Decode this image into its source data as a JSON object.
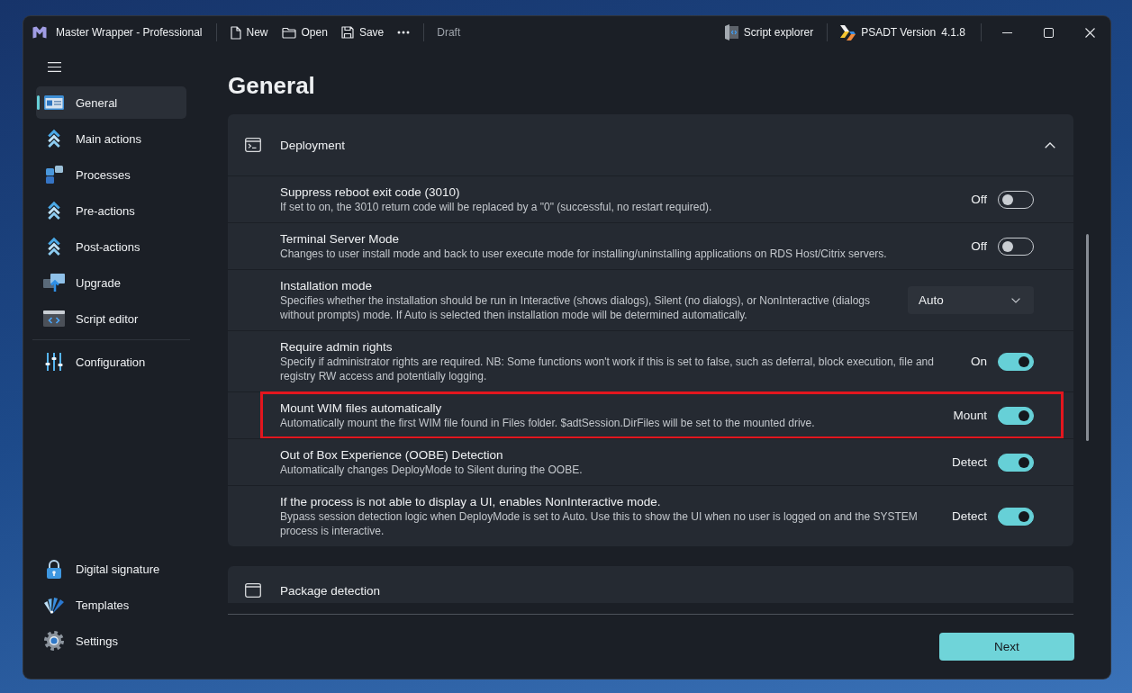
{
  "window": {
    "title": "Master Wrapper - Professional"
  },
  "toolbar": {
    "buttons": [
      {
        "label": "New"
      },
      {
        "label": "Open"
      },
      {
        "label": "Save"
      }
    ],
    "status": "Draft"
  },
  "title_bar_right": {
    "script_explorer": "Script explorer",
    "version_label": "PSADT Version",
    "version": "4.1.8"
  },
  "sidebar": {
    "main_items": [
      {
        "label": "General",
        "selected": true
      },
      {
        "label": "Main actions",
        "selected": false
      },
      {
        "label": "Processes",
        "selected": false
      },
      {
        "label": "Pre-actions",
        "selected": false
      },
      {
        "label": "Post-actions",
        "selected": false
      },
      {
        "label": "Upgrade",
        "selected": false
      },
      {
        "label": "Script editor",
        "selected": false
      }
    ],
    "tool_items": [
      {
        "label": "Configuration",
        "selected": false
      }
    ],
    "footer_items": [
      {
        "label": "Digital signature",
        "selected": false
      },
      {
        "label": "Templates",
        "selected": false
      },
      {
        "label": "Settings",
        "selected": false
      }
    ]
  },
  "page": {
    "title": "General",
    "next_button": "Next"
  },
  "sections": [
    {
      "title": "Deployment",
      "expanded": true,
      "rows": [
        {
          "kind": "toggle",
          "title": "Suppress reboot exit code (3010)",
          "description": "If set to on, the 3010 return code will be replaced by a \"0\" (successful, no restart required).",
          "value_label": "Off",
          "on": false,
          "highlighted": false
        },
        {
          "kind": "toggle",
          "title": "Terminal Server Mode",
          "description": "Changes to user install mode and back to user execute mode for installing/uninstalling applications on RDS Host/Citrix servers.",
          "value_label": "Off",
          "on": false,
          "highlighted": false
        },
        {
          "kind": "dropdown",
          "title": "Installation mode",
          "description": "Specifies whether the installation should be run in Interactive (shows dialogs), Silent (no dialogs), or NonInteractive (dialogs without prompts) mode. If Auto is selected then installation mode will be determined automatically.",
          "value": "Auto",
          "highlighted": false
        },
        {
          "kind": "toggle",
          "title": "Require admin rights",
          "description": "Specify if administrator rights are required. NB: Some functions won't work if this is set to false, such as deferral, block execution, file and registry RW access and potentially logging.",
          "value_label": "On",
          "on": true,
          "highlighted": false
        },
        {
          "kind": "toggle",
          "title": "Mount WIM files automatically",
          "description": "Automatically mount the first WIM file found in Files folder. $adtSession.DirFiles will be set to the mounted drive.",
          "value_label": "Mount",
          "on": true,
          "highlighted": true
        },
        {
          "kind": "toggle",
          "title": "Out of Box Experience (OOBE) Detection",
          "description": "Automatically changes DeployMode to Silent during the OOBE.",
          "value_label": "Detect",
          "on": true,
          "highlighted": false
        },
        {
          "kind": "toggle",
          "title": "If the process is not able to display a UI, enables NonInteractive mode.",
          "description": "Bypass session detection logic when DeployMode is set to Auto. Use this to show the UI when no user is logged on and the SYSTEM process is interactive.",
          "value_label": "Detect",
          "on": true,
          "highlighted": false
        }
      ]
    },
    {
      "title": "Package detection"
    }
  ]
}
